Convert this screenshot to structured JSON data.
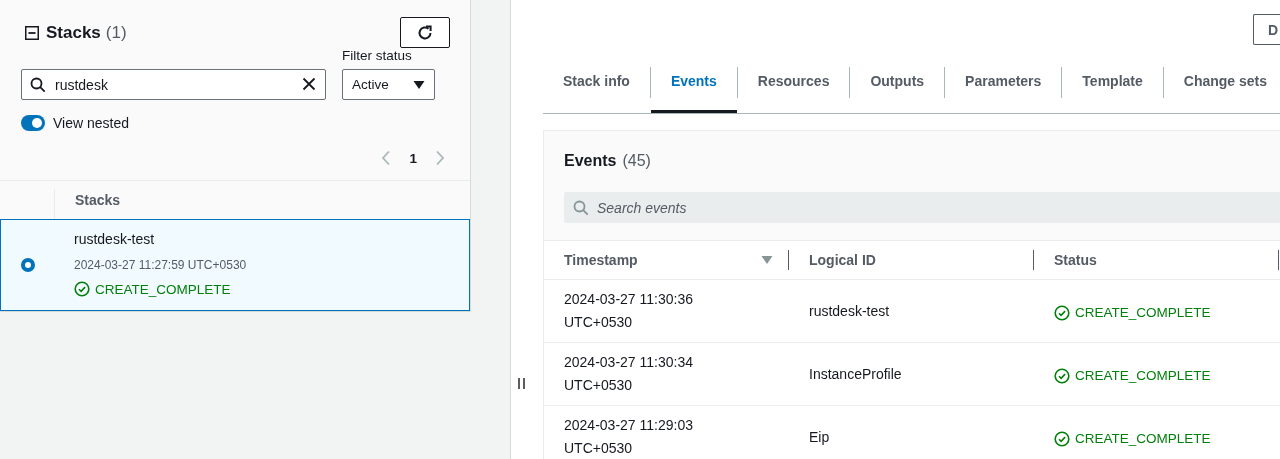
{
  "stacks_panel": {
    "title": "Stacks",
    "count": "(1)",
    "expanded": true,
    "search": {
      "value": "rustdesk"
    },
    "filter": {
      "label": "Filter status",
      "value": "Active"
    },
    "view_nested": {
      "label": "View nested",
      "on": true
    },
    "pagination": {
      "page": "1"
    },
    "table": {
      "column": "Stacks",
      "rows": [
        {
          "name": "rustdesk-test",
          "time": "2024-03-27 11:27:59 UTC+0530",
          "status": "CREATE_COMPLETE",
          "selected": true
        }
      ]
    }
  },
  "detail": {
    "action_button": "D",
    "tabs": [
      {
        "label": "Stack info",
        "selected": false
      },
      {
        "label": "Events",
        "selected": true
      },
      {
        "label": "Resources",
        "selected": false
      },
      {
        "label": "Outputs",
        "selected": false
      },
      {
        "label": "Parameters",
        "selected": false
      },
      {
        "label": "Template",
        "selected": false
      },
      {
        "label": "Change sets",
        "selected": false
      }
    ],
    "events": {
      "title": "Events",
      "count": "(45)",
      "search": {
        "placeholder": "Search events"
      },
      "columns": [
        "Timestamp",
        "Logical ID",
        "Status"
      ],
      "rows": [
        {
          "timestamp": "2024-03-27 11:30:36 UTC+0530",
          "logical_id": "rustdesk-test",
          "status": "CREATE_COMPLETE"
        },
        {
          "timestamp": "2024-03-27 11:30:34 UTC+0530",
          "logical_id": "InstanceProfile",
          "status": "CREATE_COMPLETE"
        },
        {
          "timestamp": "2024-03-27 11:29:03 UTC+0530",
          "logical_id": "Eip",
          "status": "CREATE_COMPLETE"
        }
      ]
    }
  }
}
